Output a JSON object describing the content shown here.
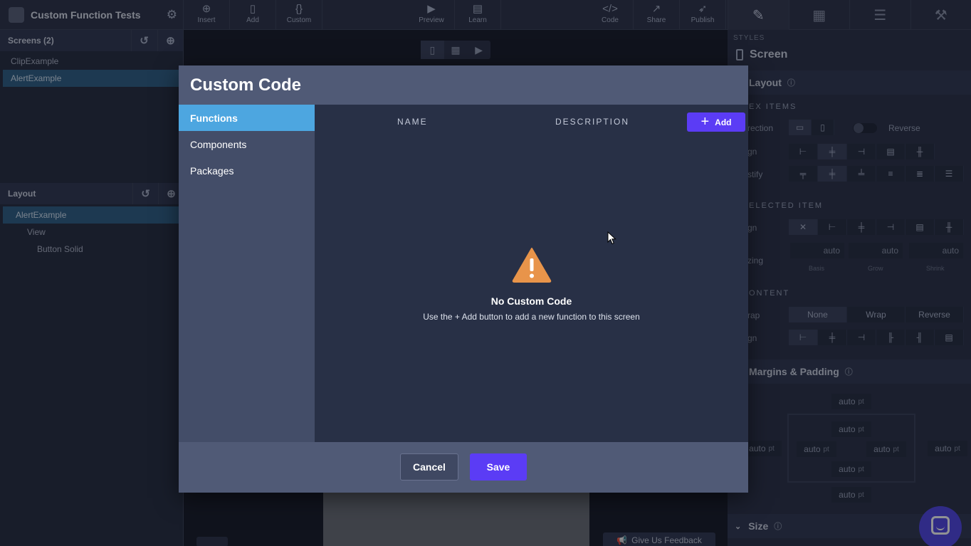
{
  "app": {
    "project_title": "Custom Function Tests",
    "toolbar": {
      "insert": "Insert",
      "add": "Add",
      "custom": "Custom",
      "preview": "Preview",
      "learn": "Learn",
      "code": "Code",
      "share": "Share",
      "publish": "Publish"
    },
    "screens_header": "Screens (2)",
    "screens": [
      "ClipExample",
      "AlertExample"
    ],
    "layout_header": "Layout",
    "layout_tree": [
      "AlertExample",
      "View",
      "Button Solid"
    ],
    "feedback": "Give Us Feedback"
  },
  "styles_panel": {
    "label": "STYLES",
    "title": "Screen",
    "layout": "Layout",
    "flex_items": "EX ITEMS",
    "direction": "rection",
    "reverse": "Reverse",
    "align": "gn",
    "justify": "stify",
    "selected_item": "ELECTED ITEM",
    "align2": "gn",
    "sizing": "zing",
    "auto": "auto",
    "basis": "Basis",
    "grow": "Grow",
    "shrink": "Shrink",
    "content": "ONTENT",
    "wrap": "rap",
    "wrap_options": [
      "None",
      "Wrap",
      "Reverse"
    ],
    "align3": "gn",
    "margins_padding": "Margins & Padding",
    "pt": "pt",
    "size": "Size"
  },
  "modal": {
    "title": "Custom Code",
    "tabs": [
      "Functions",
      "Components",
      "Packages"
    ],
    "columns": {
      "name": "NAME",
      "description": "DESCRIPTION"
    },
    "add_label": "Add",
    "empty_title": "No Custom Code",
    "empty_desc": "Use the + Add button to add a new function to this screen",
    "cancel": "Cancel",
    "save": "Save"
  },
  "colors": {
    "accent": "#5b3cf5",
    "active_tab": "#4da6e0",
    "warning": "#e8944a"
  }
}
